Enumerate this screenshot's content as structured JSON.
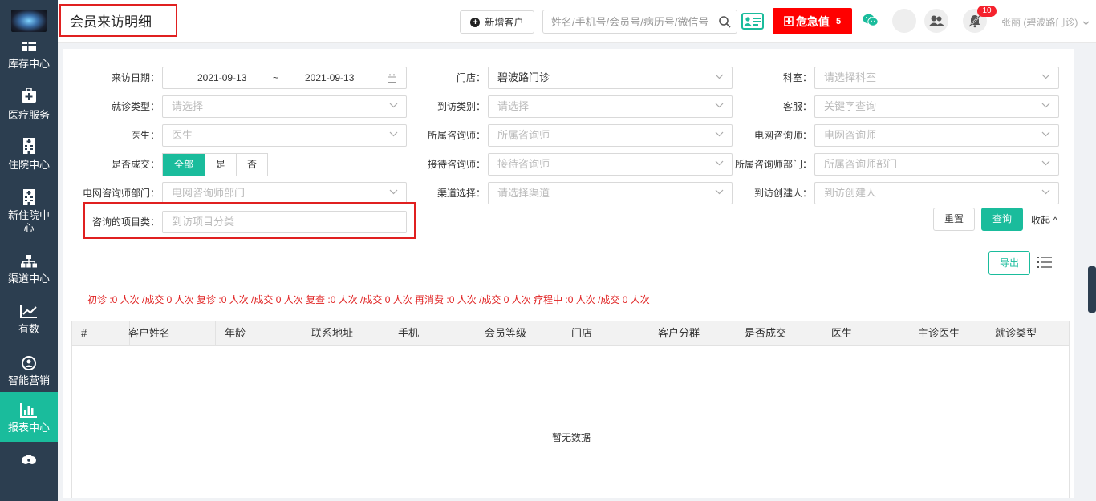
{
  "sidebar": {
    "items": [
      {
        "label": "库存中心",
        "icon": "warehouse-icon"
      },
      {
        "label": "医疗服务",
        "icon": "medical-kit-icon"
      },
      {
        "label": "住院中心",
        "icon": "hospital-icon"
      },
      {
        "label": "新住院中心",
        "icon": "hospital-icon"
      },
      {
        "label": "渠道中心",
        "icon": "org-chart-icon"
      },
      {
        "label": "有数",
        "icon": "trend-chart-icon"
      },
      {
        "label": "智能营销",
        "icon": "marketing-icon"
      },
      {
        "label": "报表中心",
        "icon": "bar-chart-icon"
      }
    ]
  },
  "header": {
    "page_title": "会员来访明细",
    "new_customer_label": "新增客户",
    "search_placeholder": "姓名/手机号/会员号/病历号/微信号",
    "danger_label": "危急值",
    "danger_count": "5",
    "notification_count": "10",
    "user_name": "张丽 (碧波路门诊)"
  },
  "filters": {
    "visit_date_label": "来访日期：",
    "date_start": "2021-09-13",
    "date_sep": "~",
    "date_end": "2021-09-13",
    "store_label": "门店：",
    "store_value": "碧波路门诊",
    "dept_label": "科室：",
    "dept_placeholder": "请选择科室",
    "visit_type_label": "就诊类型：",
    "visit_type_placeholder": "请选择",
    "arrival_type_label": "到访类别：",
    "arrival_type_placeholder": "请选择",
    "cs_label": "客服：",
    "cs_placeholder": "关键字查询",
    "doctor_label": "医生：",
    "doctor_placeholder": "医生",
    "consultant_label": "所属咨询师：",
    "consultant_placeholder": "所属咨询师",
    "online_consultant_label": "电网咨询师：",
    "online_consultant_placeholder": "电网咨询师",
    "deal_label": "是否成交：",
    "deal_options": [
      "全部",
      "是",
      "否"
    ],
    "reception_label": "接待咨询师：",
    "reception_placeholder": "接待咨询师",
    "consultant_dept_label": "所属咨询师部门：",
    "consultant_dept_placeholder": "所属咨询师部门",
    "online_dept_label": "电网咨询师部门：",
    "online_dept_placeholder": "电网咨询师部门",
    "channel_label": "渠道选择：",
    "channel_placeholder": "请选择渠道",
    "creator_label": "到访创建人：",
    "creator_placeholder": "到访创建人",
    "project_label": "咨询的项目类：",
    "project_placeholder": "到访项目分类"
  },
  "actions": {
    "reset_label": "重置",
    "query_label": "查询",
    "collapse_label": "收起 ^",
    "export_label": "导出"
  },
  "stats_line": "初诊 :0 人次 /成交 0 人次   复诊 :0 人次 /成交 0 人次   复查 :0 人次 /成交 0 人次   再消费 :0 人次 /成交 0 人次   疗程中 :0 人次 /成交 0 人次",
  "table": {
    "columns": [
      "#",
      "客户姓名",
      "年龄",
      "联系地址",
      "手机",
      "会员等级",
      "门店",
      "客户分群",
      "是否成交",
      "医生",
      "主诊医生",
      "就诊类型"
    ],
    "empty_text": "暂无数据"
  },
  "colors": {
    "sidebar_bg": "#2c3e50",
    "accent": "#1abc9c",
    "danger": "#ff0000",
    "annotation": "#e02020"
  }
}
